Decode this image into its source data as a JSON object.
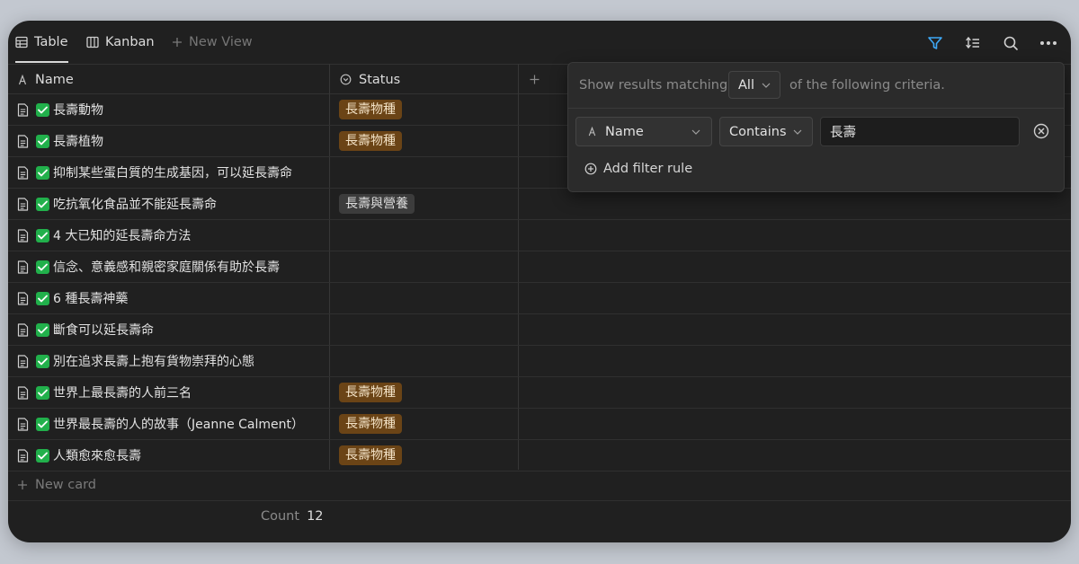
{
  "toolbar": {
    "views": [
      {
        "label": "Table",
        "icon": "table-icon"
      },
      {
        "label": "Kanban",
        "icon": "kanban-icon"
      }
    ],
    "new_view_label": "New View",
    "icons": [
      "filter-icon",
      "sort-icon",
      "search-icon",
      "more-icon"
    ],
    "filter_active_color": "#3ea8f5"
  },
  "table": {
    "columns": [
      {
        "label": "Name",
        "icon": "text-type-icon"
      },
      {
        "label": "Status",
        "icon": "select-type-icon"
      }
    ],
    "rows": [
      {
        "name": "長壽動物",
        "status": "長壽物種",
        "status_color": "brown"
      },
      {
        "name": "長壽植物",
        "status": "長壽物種",
        "status_color": "brown"
      },
      {
        "name": "抑制某些蛋白質的生成基因，可以延長壽命",
        "status": "",
        "status_color": ""
      },
      {
        "name": "吃抗氧化食品並不能延長壽命",
        "status": "長壽與營養",
        "status_color": "gray"
      },
      {
        "name": "4 大已知的延長壽命方法",
        "status": "",
        "status_color": ""
      },
      {
        "name": "信念、意義感和親密家庭關係有助於長壽",
        "status": "",
        "status_color": ""
      },
      {
        "name": "6 種長壽神藥",
        "status": "",
        "status_color": ""
      },
      {
        "name": "斷食可以延長壽命",
        "status": "",
        "status_color": ""
      },
      {
        "name": "別在追求長壽上抱有貨物崇拜的心態",
        "status": "",
        "status_color": ""
      },
      {
        "name": "世界上最長壽的人前三名",
        "status": "長壽物種",
        "status_color": "brown"
      },
      {
        "name": "世界最長壽的人的故事（Jeanne Calment）",
        "status": "長壽物種",
        "status_color": "brown"
      },
      {
        "name": "人類愈來愈長壽",
        "status": "長壽物種",
        "status_color": "brown"
      }
    ],
    "new_card_label": "New card",
    "count_label": "Count",
    "count_value": "12"
  },
  "filter": {
    "prefix": "Show results matching",
    "match_mode": "All",
    "suffix": "of the following criteria.",
    "rule": {
      "property": "Name",
      "operator": "Contains",
      "value": "長壽"
    },
    "add_rule_label": "Add filter rule"
  }
}
